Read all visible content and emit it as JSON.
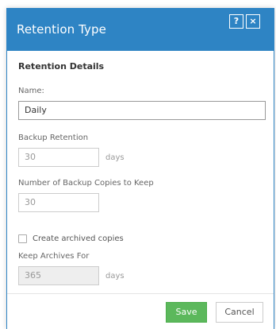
{
  "dialog": {
    "title": "Retention Type",
    "help_label": "?",
    "close_label": "×"
  },
  "form": {
    "section_title": "Retention Details",
    "name_label": "Name:",
    "name_value": "Daily",
    "backup_retention_label": "Backup Retention",
    "backup_retention_value": "30",
    "backup_retention_unit": "days",
    "copies_label": "Number of Backup Copies to Keep",
    "copies_value": "30",
    "archive_checkbox_label": "Create archived copies",
    "archive_checked": false,
    "keep_archives_label": "Keep Archives For",
    "keep_archives_value": "365",
    "keep_archives_unit": "days"
  },
  "footer": {
    "save_label": "Save",
    "cancel_label": "Cancel"
  },
  "colors": {
    "header": "#2e84c4",
    "save": "#5cb85c"
  }
}
